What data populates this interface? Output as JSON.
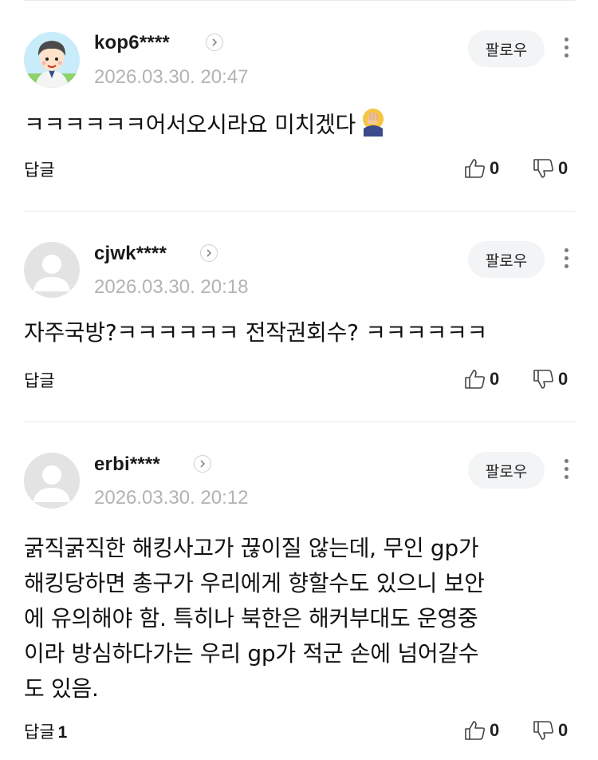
{
  "comments": [
    {
      "username": "kop6****",
      "date": "2026.03.30. 20:47",
      "follow_label": "팔로우",
      "text": "ㅋㅋㅋㅋㅋㅋ어서오시라요 미치겠다",
      "emoji": "face-palm-emoji",
      "reply_label": "답글",
      "reply_count": "",
      "likes": "0",
      "dislikes": "0",
      "avatar": "cartoon-boy-avatar"
    },
    {
      "username": "cjwk****",
      "date": "2026.03.30. 20:18",
      "follow_label": "팔로우",
      "text": "자주국방?ㅋㅋㅋㅋㅋㅋ 전작권회수? ㅋㅋㅋㅋㅋㅋ",
      "reply_label": "답글",
      "reply_count": "",
      "likes": "0",
      "dislikes": "0",
      "avatar": "default-user-avatar"
    },
    {
      "username": "erbi****",
      "date": "2026.03.30. 20:12",
      "follow_label": "팔로우",
      "text_lines": [
        "굵직굵직한 해킹사고가 끊이질 않는데, 무인 gp가",
        "해킹당하면 총구가 우리에게 향할수도 있으니 보안",
        "에 유의해야 함. 특히나 북한은 해커부대도 운영중",
        "이라 방심하다가는 우리 gp가 적군 손에 넘어갈수",
        "도 있음."
      ],
      "reply_label": "답글",
      "reply_count": "1",
      "likes": "0",
      "dislikes": "0",
      "avatar": "default-user-avatar"
    }
  ],
  "colors": {
    "date": "#b3b3b3",
    "follow_bg": "#f3f4f6",
    "divider": "#e9e9e9"
  }
}
